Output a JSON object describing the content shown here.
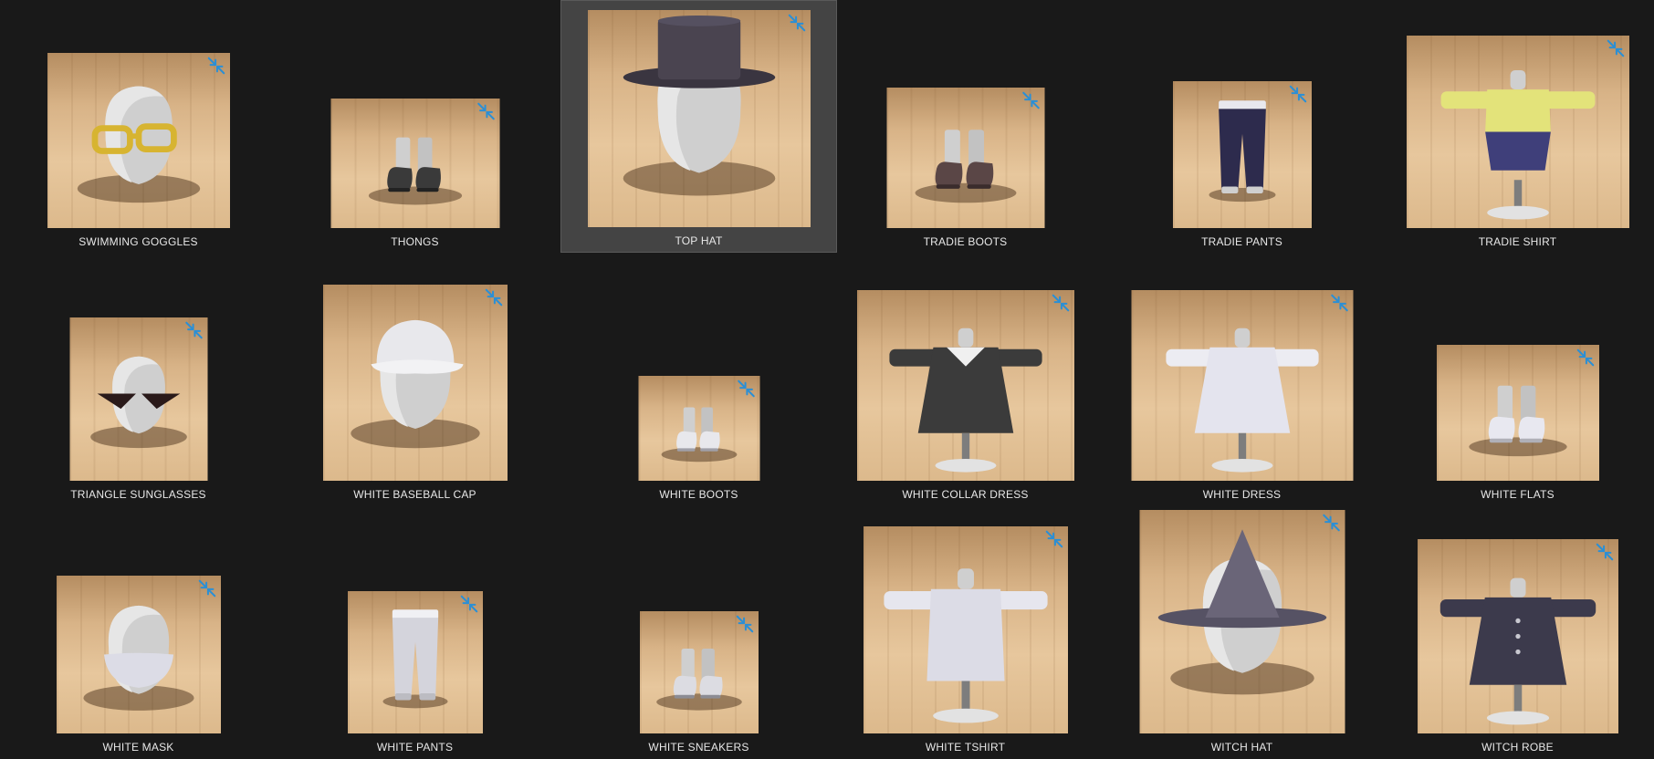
{
  "colors": {
    "background": "#191919",
    "selected_bg": "#444444",
    "badge": "#2a8fd6",
    "label": "#e8e8e8"
  },
  "items": [
    {
      "label": "SWIMMING GOGGLES",
      "art": "head-goggles",
      "icon": "swimming-goggles-thumbnail",
      "badge_icon": "compress-arrows-icon"
    },
    {
      "label": "THONGS",
      "art": "shoes-dark",
      "icon": "thongs-thumbnail",
      "badge_icon": "compress-arrows-icon"
    },
    {
      "label": "TOP HAT",
      "art": "head-tophat",
      "icon": "top-hat-thumbnail",
      "badge_icon": "compress-arrows-icon",
      "selected": true
    },
    {
      "label": "TRADIE BOOTS",
      "art": "boots-brown",
      "icon": "tradie-boots-thumbnail",
      "badge_icon": "compress-arrows-icon"
    },
    {
      "label": "TRADIE PANTS",
      "art": "pants-navy",
      "icon": "tradie-pants-thumbnail",
      "badge_icon": "compress-arrows-icon"
    },
    {
      "label": "TRADIE SHIRT",
      "art": "shirt-yellow",
      "icon": "tradie-shirt-thumbnail",
      "badge_icon": "compress-arrows-icon"
    },
    {
      "label": "TRIANGLE SUNGLASSES",
      "art": "head-sunglasses",
      "icon": "triangle-sunglasses-thumbnail",
      "badge_icon": "compress-arrows-icon"
    },
    {
      "label": "WHITE BASEBALL CAP",
      "art": "head-cap",
      "icon": "white-baseball-cap-thumbnail",
      "badge_icon": "compress-arrows-icon"
    },
    {
      "label": "WHITE BOOTS",
      "art": "shoes-white",
      "icon": "white-boots-thumbnail",
      "badge_icon": "compress-arrows-icon"
    },
    {
      "label": "WHITE COLLAR DRESS",
      "art": "dress-black",
      "icon": "white-collar-dress-thumbnail",
      "badge_icon": "compress-arrows-icon"
    },
    {
      "label": "WHITE DRESS",
      "art": "dress-white",
      "icon": "white-dress-thumbnail",
      "badge_icon": "compress-arrows-icon"
    },
    {
      "label": "WHITE FLATS",
      "art": "shoes-flats",
      "icon": "white-flats-thumbnail",
      "badge_icon": "compress-arrows-icon"
    },
    {
      "label": "WHITE MASK",
      "art": "head-mask",
      "icon": "white-mask-thumbnail",
      "badge_icon": "compress-arrows-icon"
    },
    {
      "label": "WHITE PANTS",
      "art": "pants-white",
      "icon": "white-pants-thumbnail",
      "badge_icon": "compress-arrows-icon"
    },
    {
      "label": "WHITE SNEAKERS",
      "art": "shoes-sneakers",
      "icon": "white-sneakers-thumbnail",
      "badge_icon": "compress-arrows-icon"
    },
    {
      "label": "WHITE TSHIRT",
      "art": "tshirt-white",
      "icon": "white-tshirt-thumbnail",
      "badge_icon": "compress-arrows-icon"
    },
    {
      "label": "WITCH HAT",
      "art": "head-witchhat",
      "icon": "witch-hat-thumbnail",
      "badge_icon": "compress-arrows-icon"
    },
    {
      "label": "WITCH ROBE",
      "art": "robe-dark",
      "icon": "witch-robe-thumbnail",
      "badge_icon": "compress-arrows-icon"
    }
  ]
}
